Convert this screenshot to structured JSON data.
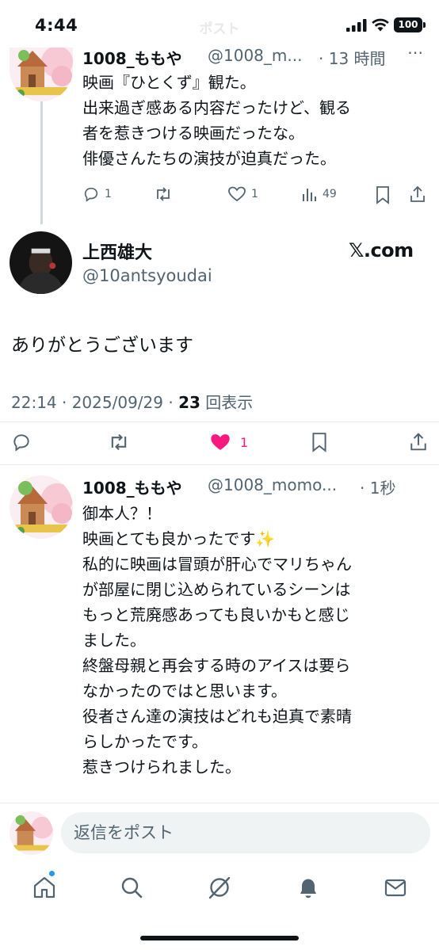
{
  "status_bar": {
    "time": "4:44",
    "faded_title": "ポスト",
    "battery": "100"
  },
  "parent_tweet": {
    "name": "1008_ももや",
    "handle": "@1008_m...",
    "time": "· 13 時間",
    "lines": [
      "映画『ひとくず』観た。",
      "出来過ぎ感ある内容だったけど、観る",
      "者を惹きつける映画だったな。",
      "俳優さんたちの演技が迫真だった。"
    ],
    "reply_count": "1",
    "like_count": "1",
    "view_count": "49"
  },
  "main_tweet": {
    "name": "上西雄大",
    "handle": "@10antsyoudai",
    "source_label": "𝕏.com",
    "text": "ありがとうございます",
    "timestamp": "22:14 · 2025/09/29 · ",
    "views": "23",
    "views_label": " 回表示",
    "like_count": "1"
  },
  "reply_tweet": {
    "name": "1008_ももや",
    "handle": "@1008_momo...",
    "time": "· 1秒",
    "lines": [
      "御本人？！",
      "映画とても良かったです✨",
      "私的に映画は冒頭が肝心でマリちゃん",
      "が部屋に閉じ込められているシーンは",
      "もっと荒廃感あっても良いかもと感じ",
      "ました。",
      "終盤母親と再会する時のアイスは要ら",
      "なかったのではと思います。",
      "役者さん達の演技はどれも迫真で素晴",
      "らしかったです。",
      "惹きつけられました。"
    ]
  },
  "reply_bar": {
    "placeholder": "返信をポスト"
  },
  "nav": {
    "items": [
      "home-icon",
      "search-icon",
      "grok-icon",
      "notifications-icon",
      "messages-icon"
    ]
  },
  "colors": {
    "like_pink": "#f91880",
    "accent_blue": "#1d9bf0",
    "secondary_text": "#536471"
  }
}
